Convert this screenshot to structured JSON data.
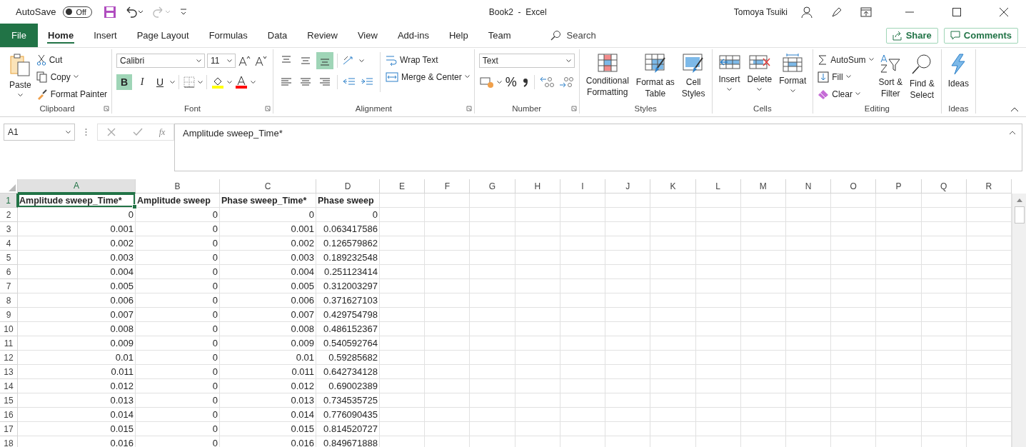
{
  "title_bar": {
    "autosave_label": "AutoSave",
    "autosave_toggle": {
      "label": "Off",
      "on": false
    },
    "document_title": "Book2  -  Excel",
    "user_name": "Tomoya Tsuiki"
  },
  "tabs": [
    {
      "label": "File",
      "selected": false
    },
    {
      "label": "Home",
      "selected": true
    },
    {
      "label": "Insert",
      "selected": false
    },
    {
      "label": "Page Layout",
      "selected": false
    },
    {
      "label": "Formulas",
      "selected": false
    },
    {
      "label": "Data",
      "selected": false
    },
    {
      "label": "Review",
      "selected": false
    },
    {
      "label": "View",
      "selected": false
    },
    {
      "label": "Add-ins",
      "selected": false
    },
    {
      "label": "Help",
      "selected": false
    },
    {
      "label": "Team",
      "selected": false
    }
  ],
  "search": {
    "placeholder": "Search"
  },
  "share_button": "Share",
  "comments_button": "Comments",
  "clipboard": {
    "paste": "Paste",
    "cut": "Cut",
    "copy": "Copy",
    "format_painter": "Format Painter",
    "group_label": "Clipboard"
  },
  "font": {
    "font_name": "Calibri",
    "font_size": "11",
    "bold": {
      "label": "B",
      "on": true
    },
    "italic": {
      "label": "I",
      "on": false
    },
    "underline": {
      "label": "U",
      "on": false
    },
    "group_label": "Font"
  },
  "alignment": {
    "align_top": false,
    "align_middle": false,
    "align_bottom": true,
    "wrap_text": "Wrap Text",
    "merge_center": "Merge & Center",
    "group_label": "Alignment"
  },
  "number": {
    "format": "Text",
    "percent": "%",
    "group_label": "Number"
  },
  "styles": {
    "conditional_formatting": "Conditional\nFormatting",
    "format_as_table": "Format as\nTable",
    "cell_styles": "Cell\nStyles",
    "group_label": "Styles"
  },
  "cells": {
    "insert": "Insert",
    "delete": "Delete",
    "format": "Format",
    "group_label": "Cells"
  },
  "editing": {
    "autosum": "AutoSum",
    "fill": "Fill",
    "clear": "Clear",
    "sort_filter": "Sort &\nFilter",
    "find_select": "Find &\nSelect",
    "group_label": "Editing"
  },
  "ideas": {
    "ideas": "Ideas",
    "group_label": "Ideas"
  },
  "formula_bar": {
    "name_box": "A1",
    "function_label": "fx",
    "content": "Amplitude sweep_Time*"
  },
  "columns": [
    {
      "letter": "A",
      "selected": true
    },
    {
      "letter": "B",
      "selected": false
    },
    {
      "letter": "C",
      "selected": false
    },
    {
      "letter": "D",
      "selected": false
    },
    {
      "letter": "E",
      "selected": false
    },
    {
      "letter": "F",
      "selected": false
    },
    {
      "letter": "G",
      "selected": false
    },
    {
      "letter": "H",
      "selected": false
    },
    {
      "letter": "I",
      "selected": false
    },
    {
      "letter": "J",
      "selected": false
    },
    {
      "letter": "K",
      "selected": false
    },
    {
      "letter": "L",
      "selected": false
    },
    {
      "letter": "M",
      "selected": false
    },
    {
      "letter": "N",
      "selected": false
    },
    {
      "letter": "O",
      "selected": false
    },
    {
      "letter": "P",
      "selected": false
    },
    {
      "letter": "Q",
      "selected": false
    },
    {
      "letter": "R",
      "selected": false
    }
  ],
  "rows": [
    {
      "number": "1",
      "selected": true,
      "kind": "header",
      "cells": [
        "Amplitude sweep_Time*",
        "Amplitude sweep",
        "Phase sweep_Time*",
        "Phase sweep"
      ]
    },
    {
      "number": "2",
      "selected": false,
      "kind": "data",
      "cells": [
        "0",
        "0",
        "0",
        "0"
      ]
    },
    {
      "number": "3",
      "selected": false,
      "kind": "data",
      "cells": [
        "0.001",
        "0",
        "0.001",
        "0.063417586"
      ]
    },
    {
      "number": "4",
      "selected": false,
      "kind": "data",
      "cells": [
        "0.002",
        "0",
        "0.002",
        "0.126579862"
      ]
    },
    {
      "number": "5",
      "selected": false,
      "kind": "data",
      "cells": [
        "0.003",
        "0",
        "0.003",
        "0.189232548"
      ]
    },
    {
      "number": "6",
      "selected": false,
      "kind": "data",
      "cells": [
        "0.004",
        "0",
        "0.004",
        "0.251123414"
      ]
    },
    {
      "number": "7",
      "selected": false,
      "kind": "data",
      "cells": [
        "0.005",
        "0",
        "0.005",
        "0.312003297"
      ]
    },
    {
      "number": "8",
      "selected": false,
      "kind": "data",
      "cells": [
        "0.006",
        "0",
        "0.006",
        "0.371627103"
      ]
    },
    {
      "number": "9",
      "selected": false,
      "kind": "data",
      "cells": [
        "0.007",
        "0",
        "0.007",
        "0.429754798"
      ]
    },
    {
      "number": "10",
      "selected": false,
      "kind": "data",
      "cells": [
        "0.008",
        "0",
        "0.008",
        "0.486152367"
      ]
    },
    {
      "number": "11",
      "selected": false,
      "kind": "data",
      "cells": [
        "0.009",
        "0",
        "0.009",
        "0.540592764"
      ]
    },
    {
      "number": "12",
      "selected": false,
      "kind": "data",
      "cells": [
        "0.01",
        "0",
        "0.01",
        "0.59285682"
      ]
    },
    {
      "number": "13",
      "selected": false,
      "kind": "data",
      "cells": [
        "0.011",
        "0",
        "0.011",
        "0.642734128"
      ]
    },
    {
      "number": "14",
      "selected": false,
      "kind": "data",
      "cells": [
        "0.012",
        "0",
        "0.012",
        "0.69002389"
      ]
    },
    {
      "number": "15",
      "selected": false,
      "kind": "data",
      "cells": [
        "0.013",
        "0",
        "0.013",
        "0.734535725"
      ]
    },
    {
      "number": "16",
      "selected": false,
      "kind": "data",
      "cells": [
        "0.014",
        "0",
        "0.014",
        "0.776090435"
      ]
    },
    {
      "number": "17",
      "selected": false,
      "kind": "data",
      "cells": [
        "0.015",
        "0",
        "0.015",
        "0.814520727"
      ]
    },
    {
      "number": "18",
      "selected": false,
      "kind": "data",
      "cells": [
        "0.016",
        "0",
        "0.016",
        "0.849671888"
      ]
    }
  ]
}
